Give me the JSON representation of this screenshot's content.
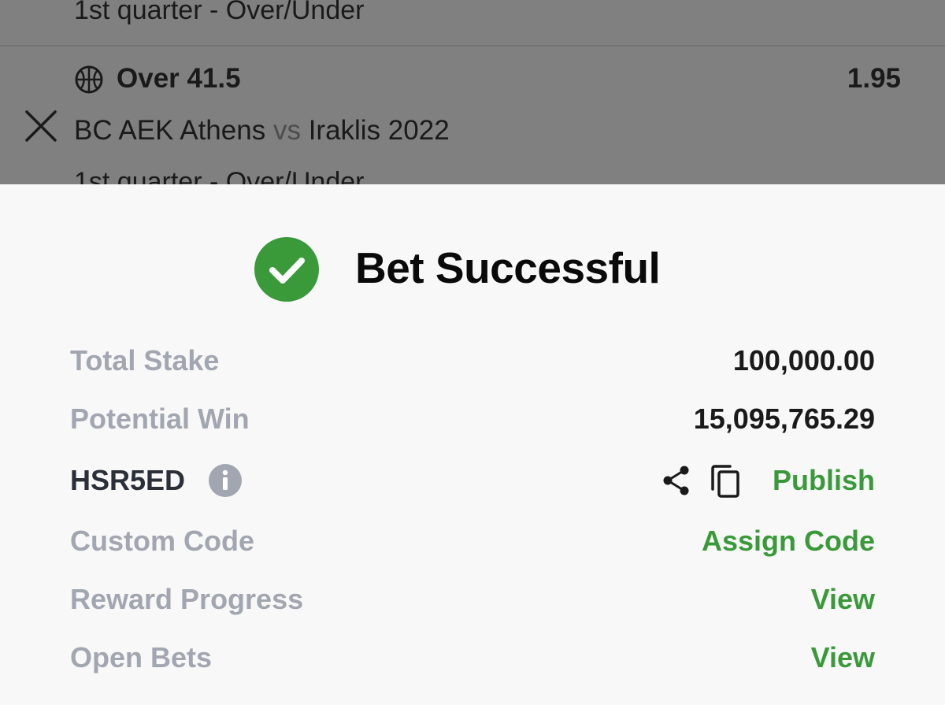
{
  "background_list": {
    "top_market": "1st quarter - Over/Under",
    "selection": "Over 41.5",
    "odds": "1.95",
    "home_team": "BC AEK Athens",
    "vs": "vs",
    "away_team": "Iraklis 2022",
    "market": "1st quarter - Over/Under"
  },
  "sheet": {
    "title": "Bet Successful",
    "total_stake_label": "Total Stake",
    "total_stake_value": "100,000.00",
    "potential_win_label": "Potential Win",
    "potential_win_value": "15,095,765.29",
    "booking_code": "HSR5ED",
    "publish_label": "Publish",
    "custom_code_label": "Custom Code",
    "assign_code_label": "Assign Code",
    "reward_progress_label": "Reward Progress",
    "reward_view_label": "View",
    "open_bets_label": "Open Bets",
    "open_bets_view_label": "View"
  },
  "colors": {
    "success_green": "#3a9a3a",
    "label_gray": "#a2a6b0",
    "overlay_gray": "#808080"
  },
  "icons": [
    "basketball-icon",
    "close-icon",
    "check-circle-icon",
    "info-icon",
    "share-icon",
    "copy-icon"
  ]
}
